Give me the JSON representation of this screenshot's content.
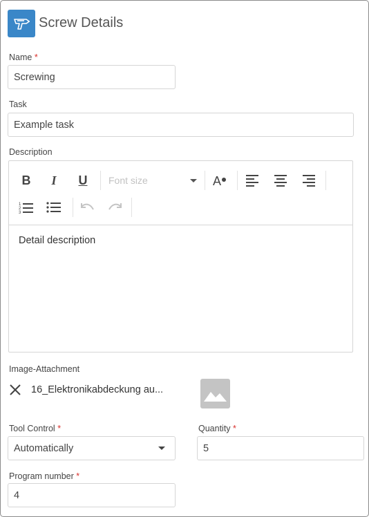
{
  "header": {
    "title": "Screw Details",
    "icon": "drill-icon",
    "accent": "#3a87c8"
  },
  "form": {
    "name": {
      "label": "Name",
      "required": "*",
      "value": "Screwing"
    },
    "task": {
      "label": "Task",
      "value": "Example task"
    },
    "description": {
      "label": "Description",
      "toolbar": {
        "bold": "B",
        "italic": "I",
        "underline": "U",
        "font_size_placeholder": "Font size"
      },
      "content": "Detail description"
    },
    "image_attachment": {
      "label": "Image-Attachment",
      "file_name": "16_Elektronikabdeckung au..."
    },
    "tool_control": {
      "label": "Tool Control",
      "required": "*",
      "value": "Automatically"
    },
    "quantity": {
      "label": "Quantity",
      "required": "*",
      "value": "5"
    },
    "program_number": {
      "label": "Program number",
      "required": "*",
      "value": "4"
    }
  },
  "colors": {
    "required": "#d9302c",
    "border": "#d5d5d5"
  }
}
